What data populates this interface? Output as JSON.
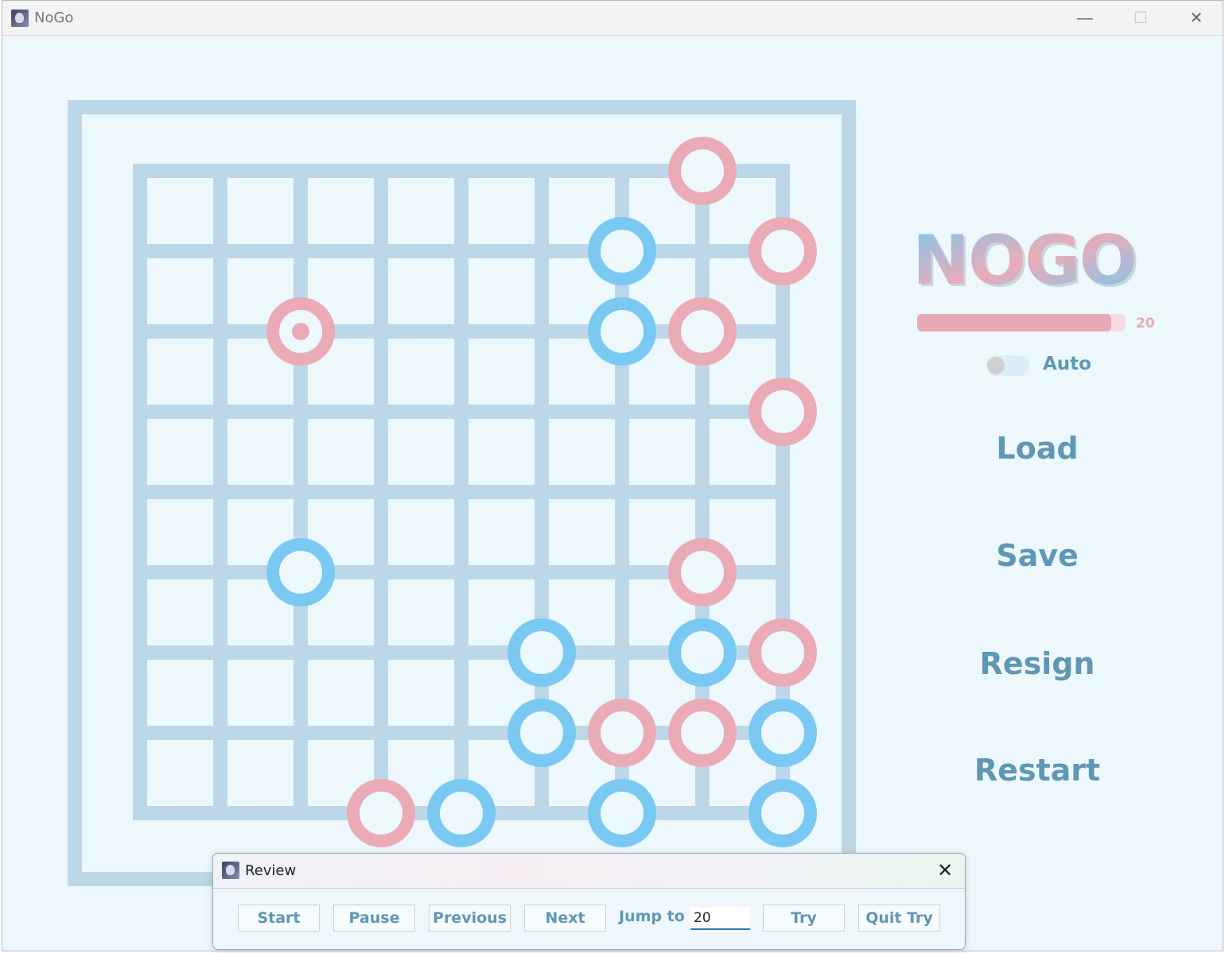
{
  "window": {
    "title": "NoGo",
    "icon": "app-avatar-icon",
    "controls": [
      "minimize-icon",
      "maximize-icon",
      "close-icon"
    ]
  },
  "board": {
    "size": 9,
    "line_color": "#bcd8e8",
    "pink_color": "#eaabb7",
    "blue_color": "#79c9f2",
    "last_move": {
      "color": "pink",
      "col": 2,
      "row": 2
    },
    "stones": [
      {
        "color": "pink",
        "col": 7,
        "row": 0
      },
      {
        "color": "blue",
        "col": 6,
        "row": 1
      },
      {
        "color": "pink",
        "col": 8,
        "row": 1
      },
      {
        "color": "pink",
        "col": 2,
        "row": 2
      },
      {
        "color": "blue",
        "col": 6,
        "row": 2
      },
      {
        "color": "pink",
        "col": 7,
        "row": 2
      },
      {
        "color": "pink",
        "col": 8,
        "row": 3
      },
      {
        "color": "blue",
        "col": 2,
        "row": 5
      },
      {
        "color": "pink",
        "col": 7,
        "row": 5
      },
      {
        "color": "blue",
        "col": 5,
        "row": 6
      },
      {
        "color": "blue",
        "col": 7,
        "row": 6
      },
      {
        "color": "pink",
        "col": 8,
        "row": 6
      },
      {
        "color": "blue",
        "col": 5,
        "row": 7
      },
      {
        "color": "pink",
        "col": 6,
        "row": 7
      },
      {
        "color": "pink",
        "col": 7,
        "row": 7
      },
      {
        "color": "blue",
        "col": 8,
        "row": 7
      },
      {
        "color": "pink",
        "col": 3,
        "row": 8
      },
      {
        "color": "blue",
        "col": 4,
        "row": 8
      },
      {
        "color": "blue",
        "col": 6,
        "row": 8
      },
      {
        "color": "blue",
        "col": 8,
        "row": 8
      }
    ]
  },
  "sidebar": {
    "logo_text": "NOGO",
    "slider": {
      "value": "20",
      "fill_fraction": 0.93
    },
    "auto_toggle": {
      "label": "Auto",
      "on": false
    },
    "buttons": {
      "load": "Load",
      "save": "Save",
      "resign": "Resign",
      "restart": "Restart"
    }
  },
  "review_dialog": {
    "title": "Review",
    "buttons": {
      "start": "Start",
      "pause": "Pause",
      "previous": "Previous",
      "next": "Next",
      "try": "Try",
      "quit_try": "Quit Try"
    },
    "jump_label": "Jump to",
    "jump_value": "20"
  }
}
